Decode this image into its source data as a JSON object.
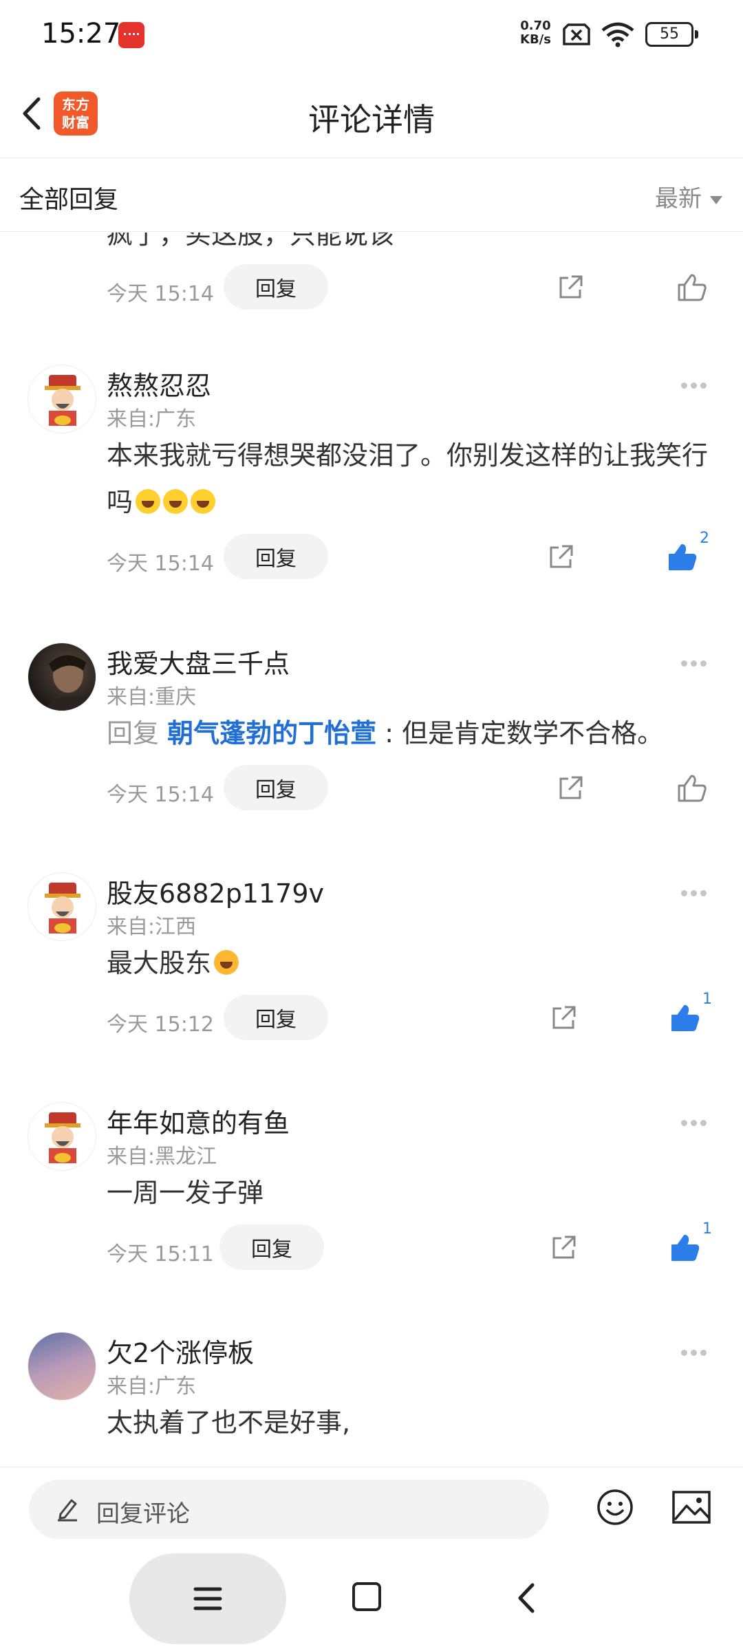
{
  "status_bar": {
    "time": "15:27",
    "net_speed_value": "0.70",
    "net_speed_unit": "KB/s",
    "battery": "55"
  },
  "header": {
    "logo_line1": "东方",
    "logo_line2": "财富",
    "title": "评论详情"
  },
  "sort_bar": {
    "title": "全部回复",
    "selected": "最新"
  },
  "partial_comment": {
    "text": "疯了，买这股，只能说该",
    "time": "今天 15:14",
    "reply_label": "回复"
  },
  "comments": [
    {
      "username": "熬熬忍忍",
      "location": "来自:广东",
      "text": "本来我就亏得想哭都没泪了。你别发这样的让我笑行吗",
      "time": "今天 15:14",
      "reply_label": "回复",
      "likes": "2",
      "liked": true
    },
    {
      "username": "我爱大盘三千点",
      "location": "来自:重庆",
      "reply_prefix": "回复",
      "mention": "朝气蓬勃的丁怡萱",
      "text": " : 但是肯定数学不合格。",
      "time": "今天 15:14",
      "reply_label": "回复",
      "liked": false
    },
    {
      "username": "股友6882p1179v",
      "location": "来自:江西",
      "text": "最大股东",
      "time": "今天 15:12",
      "reply_label": "回复",
      "likes": "1",
      "liked": true
    },
    {
      "username": "年年如意的有鱼",
      "location": "来自:黑龙江",
      "text": "一周一发子弹",
      "time": "今天 15:11",
      "reply_label": "回复",
      "likes": "1",
      "liked": true
    },
    {
      "username": "欠2个涨停板",
      "location": "来自:广东",
      "text": "太执着了也不是好事,"
    }
  ],
  "input_bar": {
    "placeholder": "回复评论"
  },
  "colors": {
    "accent_blue": "#2b7de9",
    "mention_blue": "#1f6fd6",
    "logo_orange": "#f1582a"
  },
  "icons": [
    "back-icon",
    "share-icon",
    "thumbs-up-icon",
    "more-icon",
    "pencil-icon",
    "smiley-icon",
    "image-icon",
    "menu-icon",
    "home-icon"
  ]
}
